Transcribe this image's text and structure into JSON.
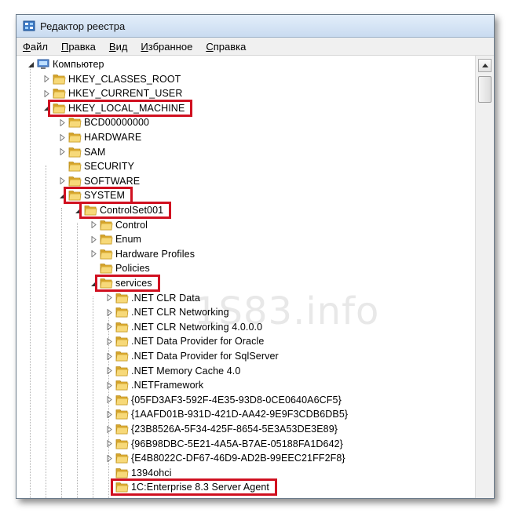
{
  "window": {
    "title": "Редактор реестра"
  },
  "menu": [
    "Файл",
    "Правка",
    "Вид",
    "Избранное",
    "Справка"
  ],
  "tree": [
    {
      "label": "Компьютер",
      "level": 0,
      "arrow": "expanded",
      "icon": "computer-icon"
    },
    {
      "label": "HKEY_CLASSES_ROOT",
      "level": 1,
      "arrow": "collapsed"
    },
    {
      "label": "HKEY_CURRENT_USER",
      "level": 1,
      "arrow": "collapsed"
    },
    {
      "label": "HKEY_LOCAL_MACHINE",
      "level": 1,
      "arrow": "expanded",
      "highlight": true
    },
    {
      "label": "BCD00000000",
      "level": 2,
      "arrow": "collapsed"
    },
    {
      "label": "HARDWARE",
      "level": 2,
      "arrow": "collapsed"
    },
    {
      "label": "SAM",
      "level": 2,
      "arrow": "collapsed"
    },
    {
      "label": "SECURITY",
      "level": 2,
      "arrow": "none"
    },
    {
      "label": "SOFTWARE",
      "level": 2,
      "arrow": "collapsed"
    },
    {
      "label": "SYSTEM",
      "level": 2,
      "arrow": "expanded",
      "highlight": true
    },
    {
      "label": "ControlSet001",
      "level": 3,
      "arrow": "expanded",
      "highlight": true
    },
    {
      "label": "Control",
      "level": 4,
      "arrow": "collapsed"
    },
    {
      "label": "Enum",
      "level": 4,
      "arrow": "collapsed"
    },
    {
      "label": "Hardware Profiles",
      "level": 4,
      "arrow": "collapsed"
    },
    {
      "label": "Policies",
      "level": 4,
      "arrow": "none"
    },
    {
      "label": "services",
      "level": 4,
      "arrow": "expanded",
      "highlight": true
    },
    {
      "label": ".NET CLR Data",
      "level": 5,
      "arrow": "collapsed"
    },
    {
      "label": ".NET CLR Networking",
      "level": 5,
      "arrow": "collapsed"
    },
    {
      "label": ".NET CLR Networking 4.0.0.0",
      "level": 5,
      "arrow": "collapsed"
    },
    {
      "label": ".NET Data Provider for Oracle",
      "level": 5,
      "arrow": "collapsed"
    },
    {
      "label": ".NET Data Provider for SqlServer",
      "level": 5,
      "arrow": "collapsed"
    },
    {
      "label": ".NET Memory Cache 4.0",
      "level": 5,
      "arrow": "collapsed"
    },
    {
      "label": ".NETFramework",
      "level": 5,
      "arrow": "collapsed"
    },
    {
      "label": "{05FD3AF3-592F-4E35-93D8-0CE0640A6CF5}",
      "level": 5,
      "arrow": "collapsed"
    },
    {
      "label": "{1AAFD01B-931D-421D-AA42-9E9F3CDB6DB5}",
      "level": 5,
      "arrow": "collapsed"
    },
    {
      "label": "{23B8526A-5F34-425F-8654-5E3A53DE3E89}",
      "level": 5,
      "arrow": "collapsed"
    },
    {
      "label": "{96B98DBC-5E21-4A5A-B7AE-05188FA1D642}",
      "level": 5,
      "arrow": "collapsed"
    },
    {
      "label": "{E4B8022C-DF67-46D9-AD2B-99EEC21FF2F8}",
      "level": 5,
      "arrow": "collapsed"
    },
    {
      "label": "1394ohci",
      "level": 5,
      "arrow": "none"
    },
    {
      "label": "1C:Enterprise 8.3 Server Agent",
      "level": 5,
      "arrow": "none",
      "highlight": true
    }
  ],
  "watermark": "1S83.info",
  "colors": {
    "highlight": "#d01020",
    "folder": "#f2c94c"
  }
}
